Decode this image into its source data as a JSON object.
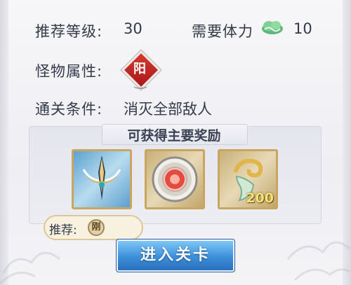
{
  "stats": {
    "recommended_level_label": "推荐等级:",
    "recommended_level_value": "30",
    "stamina_label": "需要体力",
    "stamina_value": "10",
    "monster_attr_label": "怪物属性:",
    "monster_attr_char": "阳",
    "clear_condition_label": "通关条件:",
    "clear_condition_value": "消灭全部敌人"
  },
  "rewards": {
    "title": "可获得主要奖励",
    "items": [
      {
        "name": "talisman",
        "count": ""
      },
      {
        "name": "red-orb",
        "count": ""
      },
      {
        "name": "jade-tooth",
        "count": "200"
      }
    ]
  },
  "recommend": {
    "label": "推荐:",
    "badge_char": "刚"
  },
  "enter_button": "进入关卡",
  "colors": {
    "text": "#333a4a",
    "attr_red": "#c0282a",
    "button_blue": "#3c8fd9",
    "item_border": "#c9a560"
  }
}
